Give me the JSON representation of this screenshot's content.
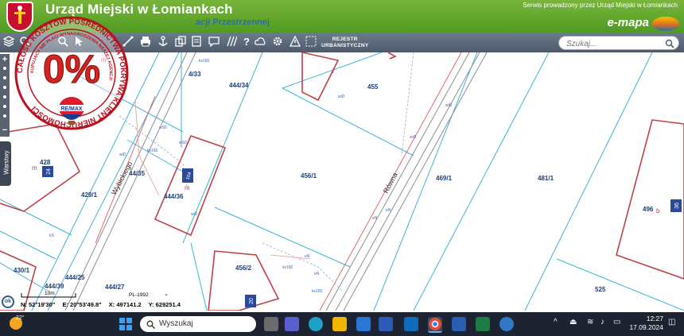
{
  "header": {
    "title": "Urząd Miejski w Łomiankach",
    "subtitle": "acji Przestrzennej",
    "service_note": "Serwis prowadzony przez Urząd Miejski w Łomiankach",
    "brand": "e-mapa"
  },
  "toolbar": {
    "rejestr_line1": "REJESTR",
    "rejestr_line2": "URBANISTYCZNY",
    "search_placeholder": "Szukaj..."
  },
  "sidebar": {
    "layers_label": "Warstwy"
  },
  "stamp": {
    "percent": "0%",
    "agency": "RE/MAX",
    "ring_text": "CAŁOŚĆ KOSZTÓW POŚREDNICTWA POKRYWA KLIENT NIERUCHOMOŚCI",
    "inner_text": "KUPUJĄCY NIE PŁACI WYNAGRODZENIA NASZEJ AGENCJI"
  },
  "map": {
    "parcels": [
      "444/34",
      "455",
      "428",
      "429/1",
      "44/35",
      "444/36",
      "456/1",
      "469/1",
      "481/1",
      "496",
      "430/1",
      "444/25",
      "444/27",
      "456/2",
      "525",
      "4/33",
      "444/39"
    ],
    "streets": [
      "Wybickiego",
      "Równa"
    ],
    "building_labels": [
      "m",
      "m",
      "m",
      "b",
      "i"
    ],
    "building_numbers": [
      "24",
      "36",
      "20",
      "104"
    ],
    "small_labels": [
      "wiD",
      "wiD",
      "wiD",
      "ks160",
      "ks160",
      "ks160",
      "wS0",
      "wS0",
      "eN",
      "eN",
      "eN",
      "kS",
      "wiD",
      "eN",
      "wiD",
      "ks160"
    ],
    "scale_label": "10m",
    "projection": "PL-1992"
  },
  "status": {
    "ok": "ok",
    "lat": "N: 52°19'30\"",
    "lon": "E: 20°53'49.8\"",
    "x": "X: 497141.2",
    "y": "Y: 629251.4"
  },
  "taskbar": {
    "temperature": "22°",
    "search_label": "Wyszukaj",
    "time": "12:27",
    "date": "17.09.2024"
  }
}
